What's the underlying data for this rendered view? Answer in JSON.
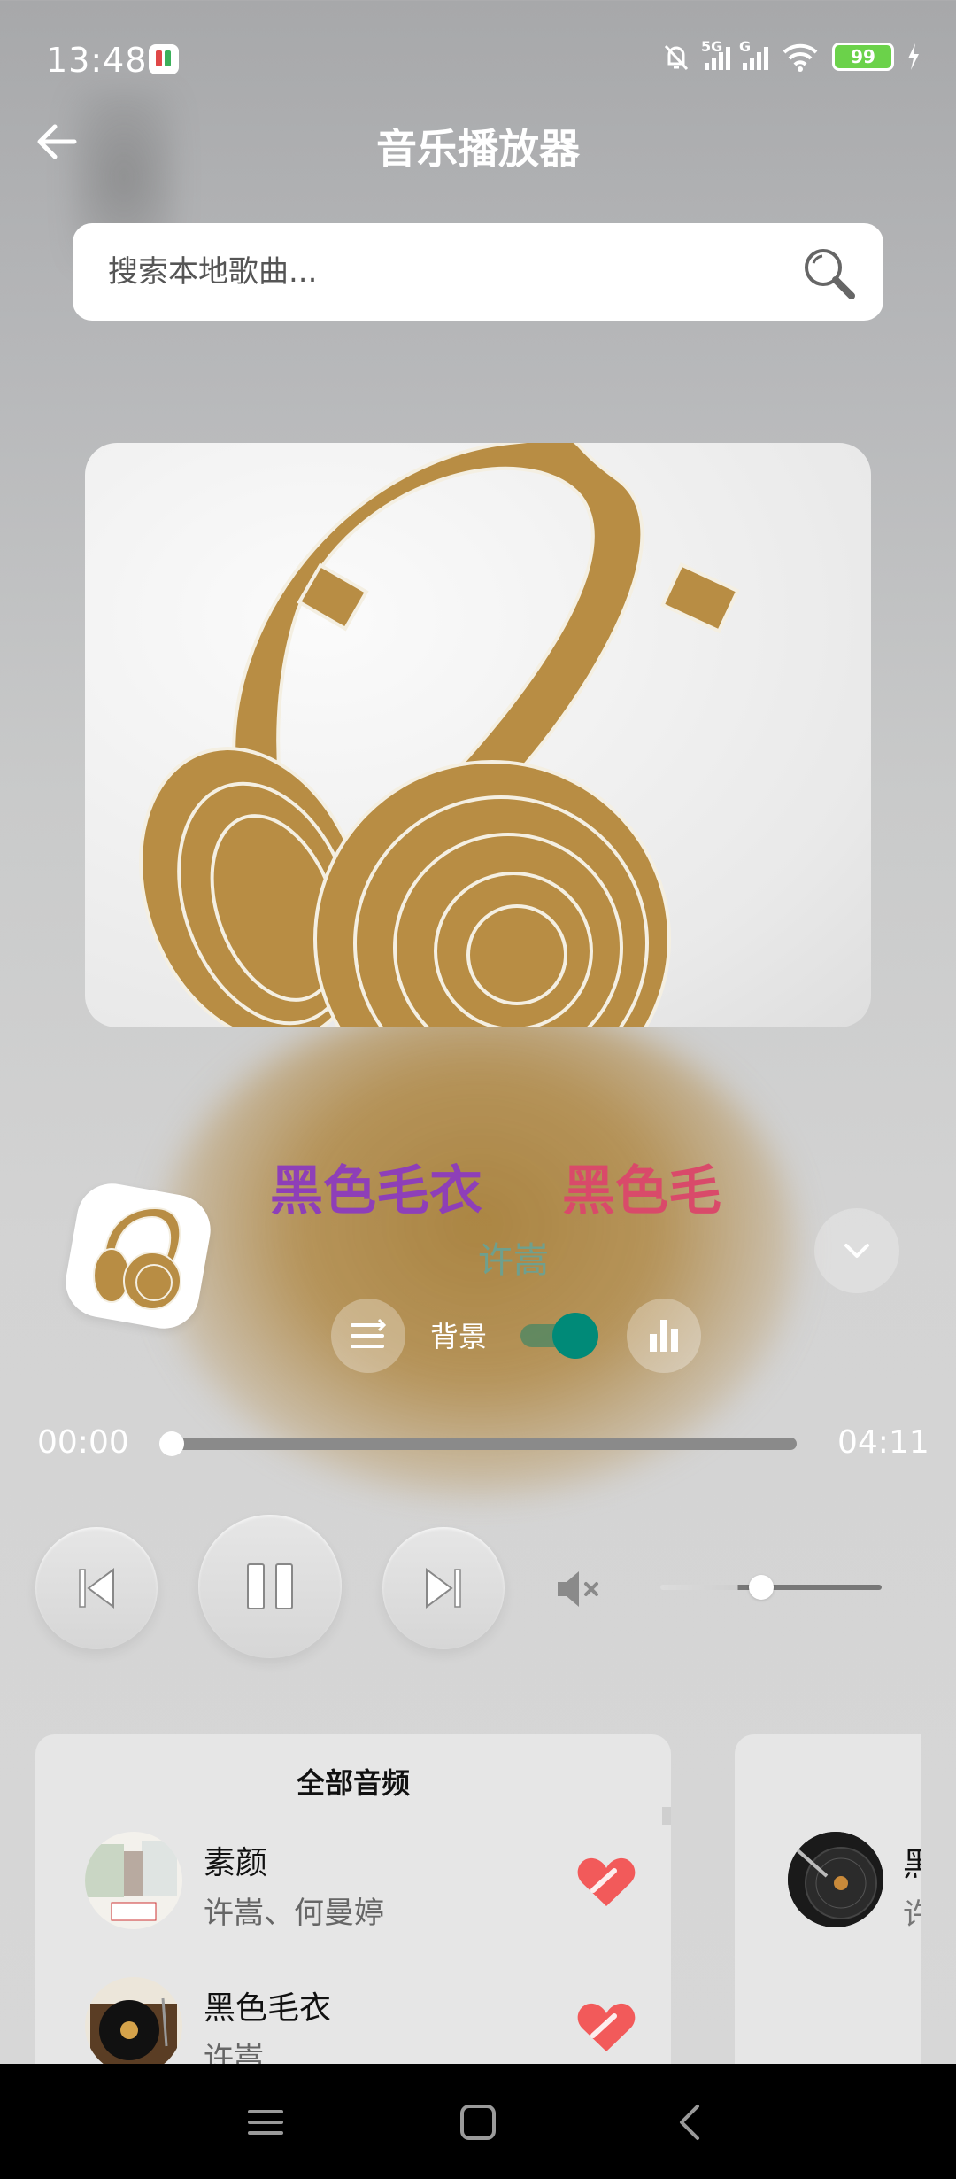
{
  "status_bar": {
    "time": "13:48",
    "network_1": "5G",
    "network_2": "G",
    "battery": "99"
  },
  "header": {
    "title": "音乐播放器"
  },
  "search": {
    "placeholder": "搜索本地歌曲..."
  },
  "now_playing": {
    "marquee": [
      "毛衣",
      "黑色毛衣",
      "黑色毛"
    ],
    "artist": "许嵩",
    "background_label": "背景",
    "background_toggle_on": true,
    "current_time": "00:00",
    "total_time": "04:11",
    "progress_fraction": 0,
    "volume_fraction": 0.35
  },
  "playlist": {
    "title": "全部音频",
    "songs": [
      {
        "name": "素颜",
        "artist": "许嵩、何曼婷",
        "favorite": true
      },
      {
        "name": "黑色毛衣",
        "artist": "许嵩",
        "favorite": true
      }
    ]
  },
  "side_card": {
    "name_fragment": "黑",
    "artist_fragment": "许"
  },
  "colors": {
    "accent_teal": "#008a78",
    "favorite_red": "#f25a5a",
    "marquee_blue": "#4a7fc0",
    "marquee_purple": "#8e3fb8",
    "marquee_pink": "#d94a6a",
    "album_gold": "#b88d44"
  }
}
